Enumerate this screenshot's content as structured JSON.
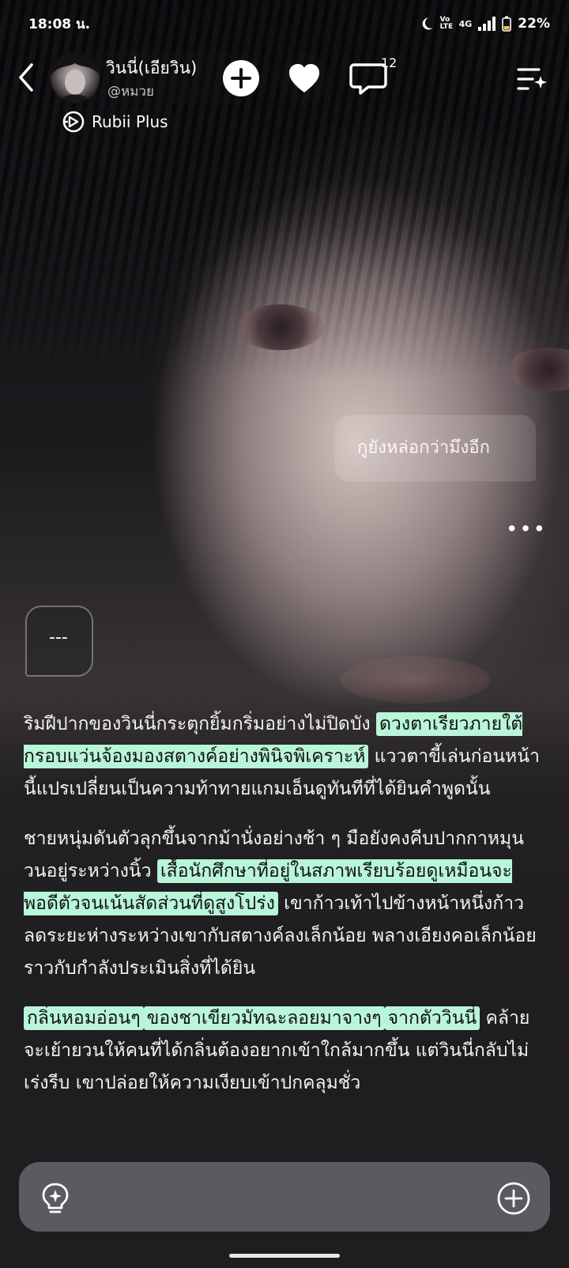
{
  "status_bar": {
    "time": "18:08 น.",
    "network": "4G",
    "volte": "Vo LTE",
    "battery": "22%"
  },
  "header": {
    "character_name": "วินนี่(เอียวิน)",
    "handle": "@หมวย",
    "comment_count": "12",
    "badge": "Rubii Plus"
  },
  "chat": {
    "user_message": "กูยังหล่อกว่ามึงอีก",
    "more_label": "•••",
    "ai_short_bubble": "---"
  },
  "story": {
    "p1": {
      "a": "ริมฝีปากของวินนี่กระตุกยิ้มกริ่มอย่างไม่ปิดบัง ",
      "hl1": "ดวงตาเรียวภายใต้กรอบแว่นจ้องมองสตางค์อย่างพินิจพิเคราะห์",
      "b": " แววตาขี้เล่นก่อนหน้านี้แปรเปลี่ยนเป็นความท้าทายแกมเอ็นดูทันทีที่ได้ยินคำพูดนั้น"
    },
    "p2": {
      "a": "ชายหนุ่มดันตัวลุกขึ้นจากม้านั่งอย่างช้า ๆ มือยังคงคีบปากกาหมุนวนอยู่ระหว่างนิ้ว ",
      "hl1": "เสื้อนักศึกษาที่อยู่ในสภาพเรียบร้อยดูเหมือนจะพอดีตัวจนเน้นสัดส่วนที่ดูสูงโปร่ง",
      "b": " เขาก้าวเท้าไปข้างหน้าหนึ่งก้าว ลดระยะห่างระหว่างเขากับสตางค์ลงเล็กน้อย พลางเอียงคอเล็กน้อยราวกับกำลังประเมินสิ่งที่ได้ยิน"
    },
    "p3": {
      "hl1": "กลิ่นหอมอ่อนๆ",
      "hl2": "ของชาเขียวมัทฉะลอยมาจางๆ",
      "hl3": "จากตัววินนี่",
      "b": " คล้ายจะเย้ายวนให้คนที่ได้กลิ่นต้องอยากเข้าใกล้มากขึ้น แต่วินนี่กลับไม่เร่งรีบ เขาปล่อยให้ความเงียบเข้าปกคลุมชั่ว"
    }
  },
  "colors": {
    "highlight": "#b9f5d9"
  },
  "icons": {
    "back": "chevron-left-icon",
    "add": "plus-icon",
    "like": "heart-icon",
    "comments": "chat-bubble-icon",
    "menu": "sparkle-menu-icon",
    "badge": "rubii-logo-icon",
    "hint": "lightbulb-icon",
    "attach": "plus-circle-icon"
  }
}
